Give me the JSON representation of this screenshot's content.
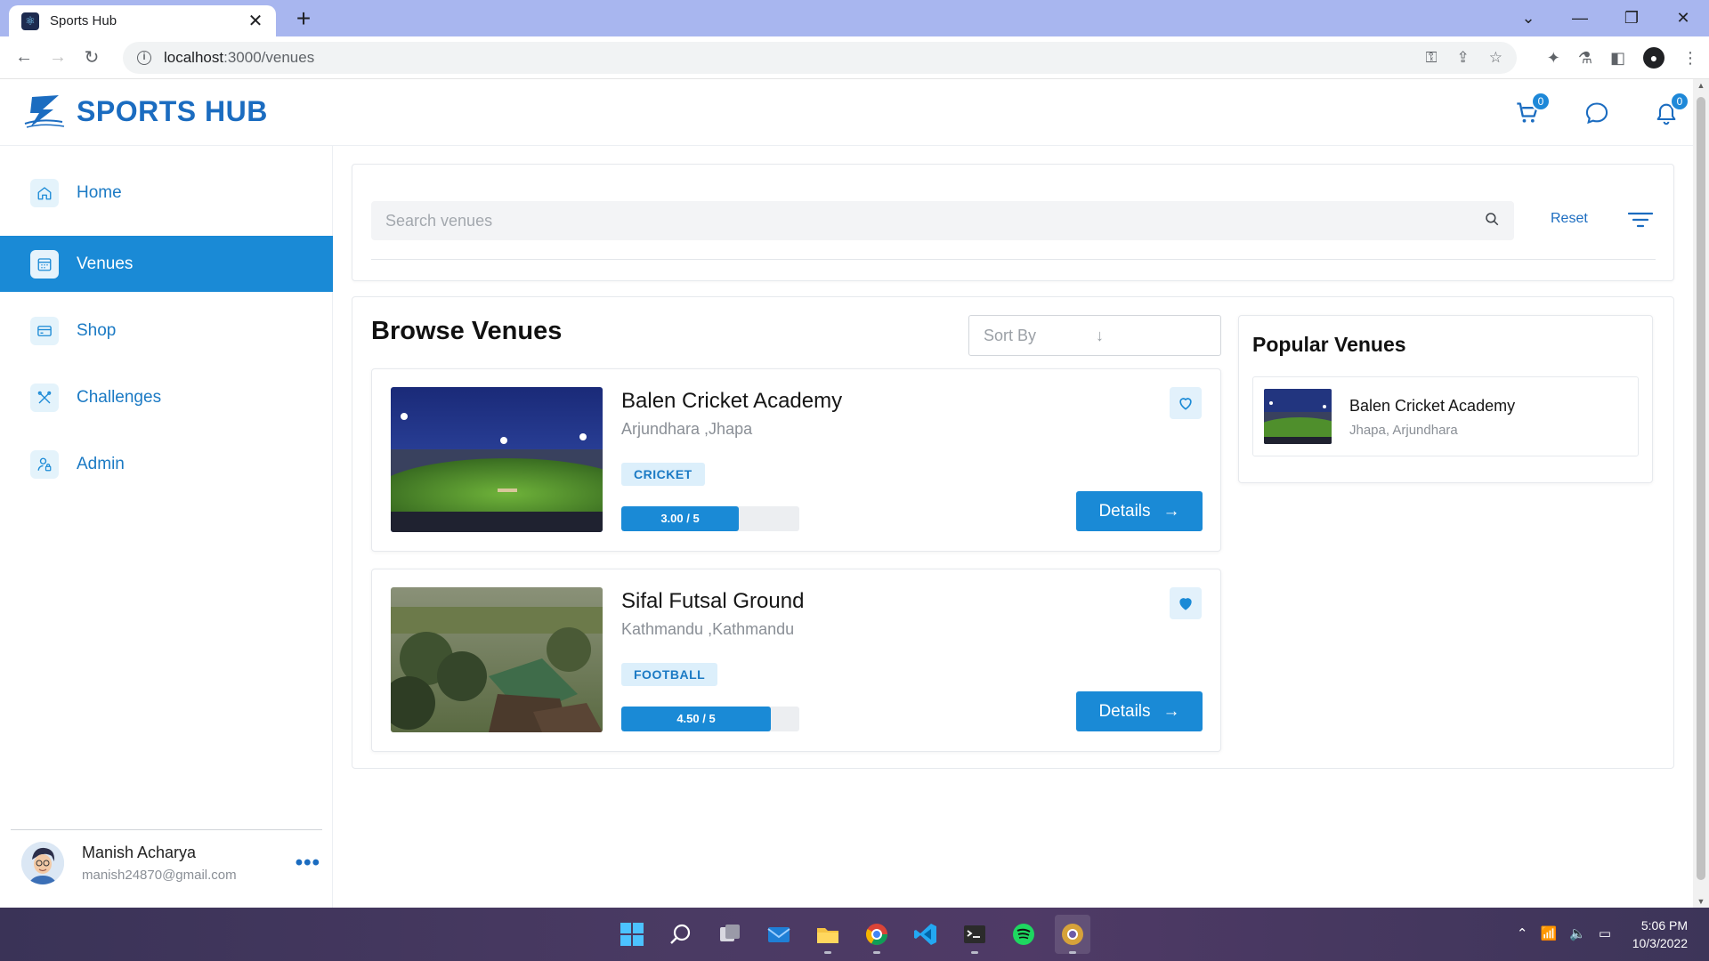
{
  "browser": {
    "tab_title": "Sports Hub",
    "url_host": "localhost",
    "url_path": ":3000/venues"
  },
  "app": {
    "logo_text": "SPORTS HUB",
    "cart_count": "0",
    "notification_count": "0"
  },
  "sidebar": {
    "items": [
      {
        "label": "Home",
        "icon": "home-icon"
      },
      {
        "label": "Venues",
        "icon": "calendar-icon"
      },
      {
        "label": "Shop",
        "icon": "card-icon"
      },
      {
        "label": "Challenges",
        "icon": "crossed-tools-icon"
      },
      {
        "label": "Admin",
        "icon": "user-lock-icon"
      }
    ],
    "active_index": 1,
    "user": {
      "name": "Manish Acharya",
      "email": "manish24870@gmail.com",
      "more": "•••"
    }
  },
  "search": {
    "placeholder": "Search venues",
    "reset_label": "Reset"
  },
  "browse": {
    "title": "Browse Venues",
    "sort_placeholder": "Sort By",
    "venues": [
      {
        "name": "Balen Cricket Academy",
        "location": "Arjundhara ,Jhapa",
        "sport": "CRICKET",
        "rating_text": "3.00 / 5",
        "rating": 3.0,
        "rating_max": 5,
        "favorited": false,
        "details_label": "Details"
      },
      {
        "name": "Sifal Futsal Ground",
        "location": "Kathmandu ,Kathmandu",
        "sport": "FOOTBALL",
        "rating_text": "4.50 / 5",
        "rating": 4.5,
        "rating_max": 5,
        "favorited": true,
        "details_label": "Details"
      }
    ]
  },
  "popular": {
    "title": "Popular Venues",
    "items": [
      {
        "name": "Balen Cricket Academy",
        "location": "Jhapa, Arjundhara"
      }
    ]
  },
  "taskbar": {
    "time": "5:06 PM",
    "date": "10/3/2022"
  },
  "colors": {
    "primary": "#1a8ad6",
    "brand": "#1b6cc0",
    "tag_bg": "#dceffb",
    "tabbar": "#a8b6ef"
  }
}
